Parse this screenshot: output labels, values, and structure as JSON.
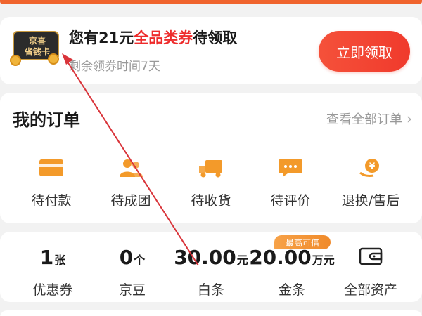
{
  "colors": {
    "brand_orange": "#f0642d",
    "highlight_red": "#ee2b2b",
    "button_red": "#f03a2c",
    "icon_orange": "#f39a2a",
    "annotation_red": "#d9343a"
  },
  "promo": {
    "card_line1": "京喜",
    "card_line2": "省钱卡",
    "title_prefix": "您有21元",
    "title_highlight": "全品类券",
    "title_suffix": "待领取",
    "subtitle": "剩余领券时间7天",
    "button_label": "立即领取"
  },
  "orders": {
    "title": "我的订单",
    "view_all": "查看全部订单",
    "items": [
      {
        "label": "待付款",
        "icon": "wallet-card-icon"
      },
      {
        "label": "待成团",
        "icon": "group-icon"
      },
      {
        "label": "待收货",
        "icon": "truck-icon"
      },
      {
        "label": "待评价",
        "icon": "comment-icon"
      },
      {
        "label": "退换/售后",
        "icon": "refund-icon"
      }
    ]
  },
  "assets": {
    "badge": "最高可借",
    "items": [
      {
        "value": "1",
        "unit": "张",
        "label": "优惠券"
      },
      {
        "value": "0",
        "unit": "个",
        "label": "京豆"
      },
      {
        "value": "30.00",
        "unit": "元",
        "label": "白条"
      },
      {
        "value": "20.00",
        "unit": "万元",
        "label": "金条"
      },
      {
        "value": "",
        "unit": "",
        "label": "全部资产",
        "icon": "wallet-icon"
      }
    ]
  }
}
